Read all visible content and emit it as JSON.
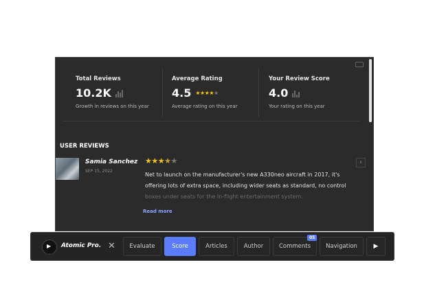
{
  "stats": [
    {
      "label": "Total Reviews",
      "value": "10.2K",
      "sub": "Growth in reviews on this year"
    },
    {
      "label": "Average Rating",
      "value": "4.5",
      "sub": "Average rating on this year"
    },
    {
      "label": "Your Review Score",
      "value": "4.0",
      "sub": "Your rating on this year"
    }
  ],
  "reviews": {
    "heading": "USER REVIEWS",
    "name": "Samia Sanchez",
    "date": "SEP 15, 2022",
    "text_visible": "Net to launch on the manufacturer's new A330neo aircraft in 2017, it's offering lots of extra space, including wider seats as standard, no control",
    "text_faded": "boxes under seats for the In-flight entertainment system.",
    "read_more": "Read more",
    "close": "x"
  },
  "toolbar": {
    "brand": "Atomic Pro.",
    "close": "✕",
    "tabs": [
      "Evaluate",
      "Score",
      "Articles",
      "Author",
      "Comments",
      "Navigation"
    ],
    "active": "Score",
    "comments_badge": "05"
  },
  "colors": {
    "accent": "#5b7cff",
    "star": "#f5c518",
    "panel": "#2b2b2b"
  }
}
